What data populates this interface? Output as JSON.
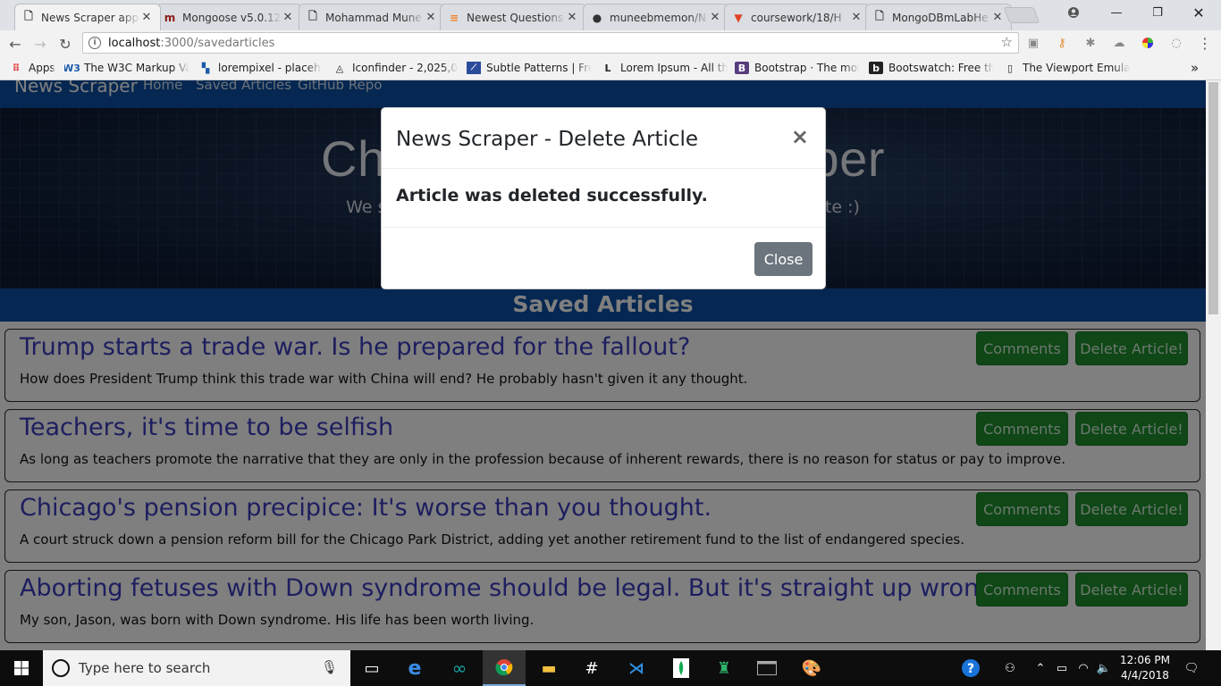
{
  "browser": {
    "tabs": [
      {
        "title": "News Scraper app",
        "icon": "document-icon",
        "active": true
      },
      {
        "title": "Mongoose v5.0.12",
        "icon": "mongoose-icon",
        "active": false
      },
      {
        "title": "Mohammad Mune",
        "icon": "document-icon",
        "active": false
      },
      {
        "title": "Newest Questions",
        "icon": "stackoverflow-icon",
        "active": false
      },
      {
        "title": "muneebmemon/N",
        "icon": "github-icon",
        "active": false
      },
      {
        "title": "coursework/18/H",
        "icon": "gitlab-icon",
        "active": false
      },
      {
        "title": "MongoDBmLabHe",
        "icon": "document-icon",
        "active": false
      }
    ],
    "url_host": "localhost",
    "url_path": ":3000/savedarticles",
    "bookmarks": [
      {
        "label": "Apps",
        "icon": "apps-grid-icon"
      },
      {
        "label": "The W3C Markup Val",
        "icon": "w3c-icon"
      },
      {
        "label": "lorempixel - placehol",
        "icon": "lorempixel-icon"
      },
      {
        "label": "Iconfinder - 2,025,000",
        "icon": "iconfinder-icon"
      },
      {
        "label": "Subtle Patterns | Free",
        "icon": "subtle-patterns-icon"
      },
      {
        "label": "Lorem Ipsum - All the",
        "icon": "lorem-ipsum-icon"
      },
      {
        "label": "Bootstrap · The most",
        "icon": "bootstrap-icon"
      },
      {
        "label": "Bootswatch: Free the",
        "icon": "bootswatch-icon"
      },
      {
        "label": "The Viewport Emulat",
        "icon": "viewport-icon"
      }
    ],
    "bookmarks_overflow": "»"
  },
  "site": {
    "brand": "News Scraper",
    "nav": [
      "Home",
      "Saved Articles",
      "GitHub Repo"
    ],
    "hero_title": "Chicago Tribune Scraper",
    "hero_subtitle": "We scrape news articles from the Chicago Tribune website :)",
    "section_title": "Saved Articles",
    "comments_label": "Comments",
    "delete_label": "Delete Article!",
    "articles": [
      {
        "title": "Trump starts a trade war. Is he prepared for the fallout?",
        "summary": "How does President Trump think this trade war with China will end? He probably hasn't given it any thought."
      },
      {
        "title": "Teachers, it's time to be selfish",
        "summary": "As long as teachers promote the narrative that they are only in the profession because of inherent rewards, there is no reason for status or pay to improve."
      },
      {
        "title": "Chicago's pension precipice: It's worse than you thought.",
        "summary": "A court struck down a pension reform bill for the Chicago Park District, adding yet another retirement fund to the list of endangered species."
      },
      {
        "title": "Aborting fetuses with Down syndrome should be legal. But it's straight up wrong.",
        "summary": "My son, Jason, was born with Down syndrome. His life has been worth living."
      }
    ]
  },
  "modal": {
    "title": "News Scraper - Delete Article",
    "close_glyph": "×",
    "message": "Article was deleted successfully.",
    "button": "Close"
  },
  "taskbar": {
    "search_placeholder": "Type here to search",
    "time": "12:06 PM",
    "date": "4/4/2018",
    "pinned": [
      "task-view-icon",
      "edge-icon",
      "arduino-icon",
      "chrome-icon",
      "file-explorer-icon",
      "slack-icon",
      "vscode-icon",
      "mongodb-compass-icon",
      "gitkraken-icon",
      "terminal-icon",
      "paint-icon"
    ]
  },
  "colors": {
    "navbar": "#0a4fa3",
    "button_green": "#1e8f2e",
    "article_title": "#3b3dbf",
    "modal_button": "#6c757d"
  }
}
